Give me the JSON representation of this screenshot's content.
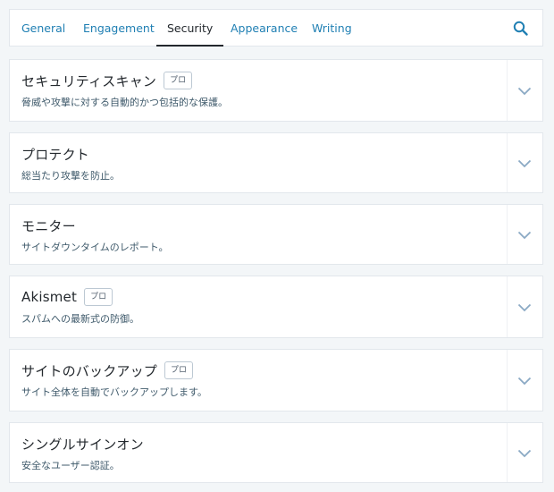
{
  "tabs": [
    {
      "label": "General",
      "active": false
    },
    {
      "label": "Engagement",
      "active": false
    },
    {
      "label": "Security",
      "active": true
    },
    {
      "label": "Appearance",
      "active": false
    },
    {
      "label": "Writing",
      "active": false
    }
  ],
  "search": {
    "icon": "search-icon"
  },
  "cards": [
    {
      "title": "セキュリティスキャン",
      "badge": "プロ",
      "description": "脅威や攻撃に対する自動的かつ包括的な保護。"
    },
    {
      "title": "プロテクト",
      "badge": "",
      "description": "総当たり攻撃を防止。"
    },
    {
      "title": "モニター",
      "badge": "",
      "description": "サイトダウンタイムのレポート。"
    },
    {
      "title": "Akismet",
      "badge": "プロ",
      "description": "スパムへの最新式の防御。"
    },
    {
      "title": "サイトのバックアップ",
      "badge": "プロ",
      "description": "サイト全体を自動でバックアップします。"
    },
    {
      "title": "シングルサインオン",
      "badge": "",
      "description": "安全なユーザー認証。"
    }
  ],
  "colors": {
    "accent": "#1f7fb3",
    "text": "#23282d",
    "chevron": "#8aa9c4",
    "background": "#f3f6f8"
  }
}
